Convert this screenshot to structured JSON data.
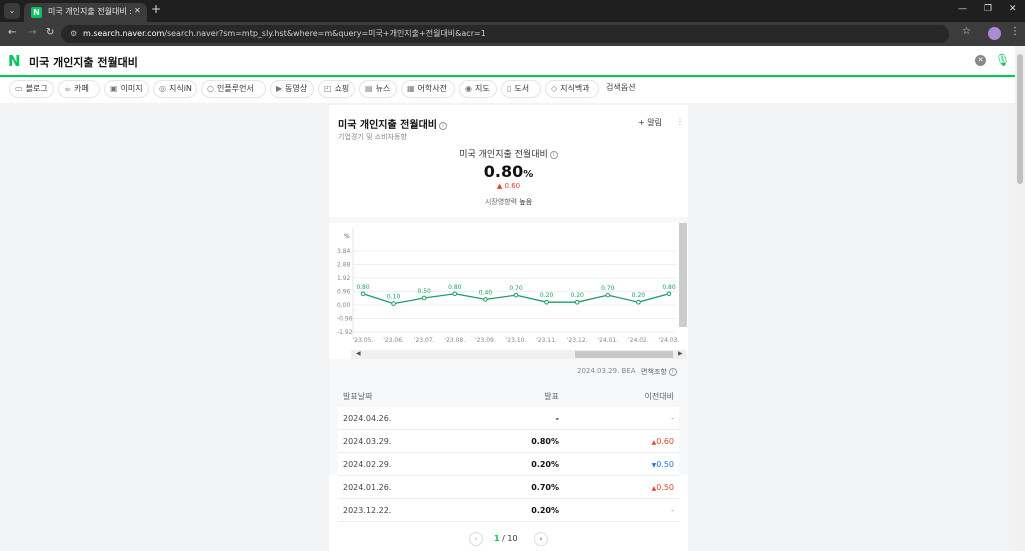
{
  "browser": {
    "tab_title": "미국 개인지출 전월대비 : 네이",
    "favicon": "N",
    "url_host": "m.search.naver.com",
    "url_path": "/search.naver?sm=mtp_sly.hst&where=m&query=미국+개인지출+전월대비&acr=1"
  },
  "search": {
    "logo": "N",
    "query": "미국 개인지출 전월대비"
  },
  "chips": [
    {
      "label": "블로그",
      "icon": "blog-icon",
      "glyph": "▭"
    },
    {
      "label": "카페",
      "icon": "cafe-icon",
      "glyph": "☕"
    },
    {
      "label": "이미지",
      "icon": "image-icon",
      "glyph": "▣"
    },
    {
      "label": "지식iN",
      "icon": "qa-icon",
      "glyph": "◎"
    },
    {
      "label": "인플루언서",
      "icon": "influencer-icon",
      "glyph": "○"
    },
    {
      "label": "동영상",
      "icon": "video-icon",
      "glyph": "▶"
    },
    {
      "label": "쇼핑",
      "icon": "shopping-icon",
      "glyph": "◰"
    },
    {
      "label": "뉴스",
      "icon": "news-icon",
      "glyph": "▤"
    },
    {
      "label": "어학사전",
      "icon": "dictionary-icon",
      "glyph": "▦"
    },
    {
      "label": "지도",
      "icon": "map-pin-icon",
      "glyph": "◉"
    },
    {
      "label": "도서",
      "icon": "book-icon",
      "glyph": "▯"
    },
    {
      "label": "지식백과",
      "icon": "encyclopedia-icon",
      "glyph": "◇"
    },
    {
      "label": "검색옵션",
      "icon": "",
      "glyph": ""
    }
  ],
  "card": {
    "title": "미국 개인지출 전월대비",
    "subtitle": "기업경기 및 소비자동향",
    "alert_label": "알림",
    "metric_label": "미국 개인지출 전월대비",
    "metric_value": "0.80",
    "metric_unit": "%",
    "metric_change": "0.60",
    "impact_label": "시장영향력",
    "impact_value": "높음",
    "source_text": "2024.03.29. BEA",
    "source_link": "면책조항"
  },
  "chart_data": {
    "type": "line",
    "y_unit_label": "%",
    "x": [
      "'23.05.",
      "'23.06.",
      "'23.07.",
      "'23.08.",
      "'23.09.",
      "'23.10.",
      "'23.11.",
      "'23.12.",
      "'24.01.",
      "'24.02.",
      "'24.03."
    ],
    "series": [
      {
        "values": [
          0.8,
          0.1,
          0.5,
          0.8,
          0.4,
          0.7,
          0.2,
          0.2,
          0.7,
          0.2,
          0.8
        ]
      }
    ],
    "value_labels": [
      "0.80",
      "0.10",
      "0.50",
      "0.80",
      "0.40",
      "0.70",
      "0.20",
      "0.20",
      "0.70",
      "0.20",
      "0.80"
    ],
    "y_ticks": [
      "3.84",
      "2.88",
      "1.92",
      "0.96",
      "0.00",
      "-0.96",
      "-1.92"
    ],
    "ylim": [
      -1.92,
      3.84
    ],
    "grid": true,
    "color": "#1a9f64"
  },
  "table": {
    "headers": [
      "발표날짜",
      "발표",
      "이전대비"
    ],
    "rows": [
      {
        "date": "2024.04.26.",
        "value": "-",
        "change": "-",
        "dir": "none"
      },
      {
        "date": "2024.03.29.",
        "value": "0.80%",
        "change": "0.60",
        "dir": "up"
      },
      {
        "date": "2024.02.29.",
        "value": "0.20%",
        "change": "0.50",
        "dir": "down"
      },
      {
        "date": "2024.01.26.",
        "value": "0.70%",
        "change": "0.50",
        "dir": "up"
      },
      {
        "date": "2023.12.22.",
        "value": "0.20%",
        "change": "-",
        "dir": "none"
      }
    ]
  },
  "pager": {
    "current": "1",
    "separator": "/",
    "total": "10"
  }
}
